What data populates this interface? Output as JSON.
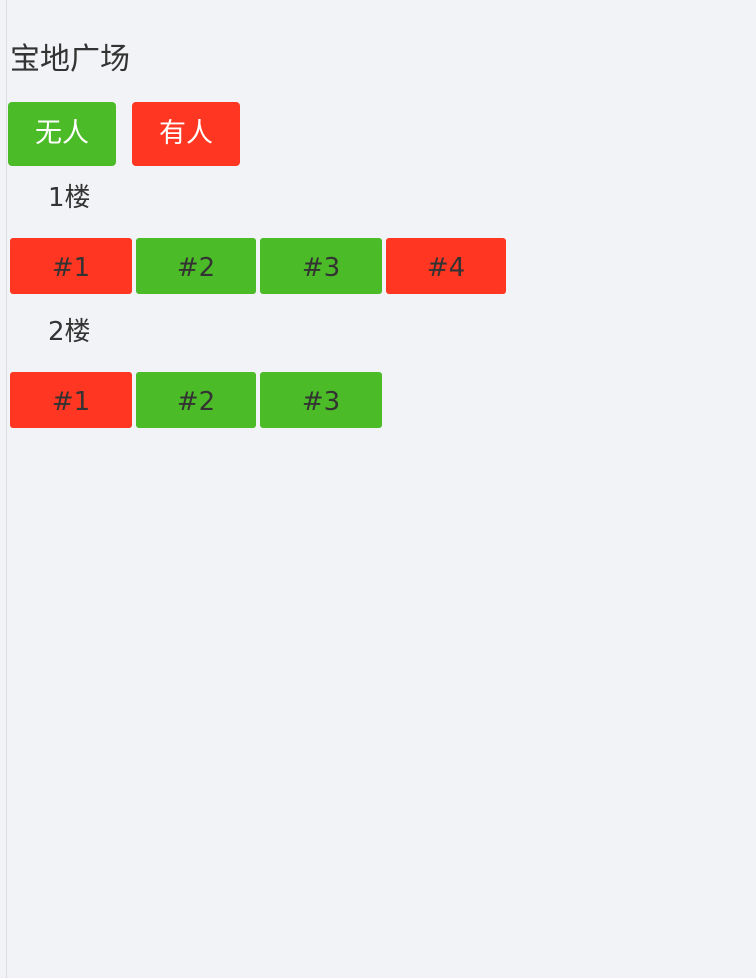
{
  "title": "宝地广场",
  "colors": {
    "empty": "#4cbb28",
    "occupied": "#ff3621"
  },
  "legend": {
    "empty_label": "无人",
    "occupied_label": "有人"
  },
  "floors": [
    {
      "label": "1楼",
      "rooms": [
        {
          "label": "#1",
          "status": "occupied"
        },
        {
          "label": "#2",
          "status": "empty"
        },
        {
          "label": "#3",
          "status": "empty"
        },
        {
          "label": "#4",
          "status": "occupied"
        }
      ]
    },
    {
      "label": "2楼",
      "rooms": [
        {
          "label": "#1",
          "status": "occupied"
        },
        {
          "label": "#2",
          "status": "empty"
        },
        {
          "label": "#3",
          "status": "empty"
        }
      ]
    }
  ]
}
